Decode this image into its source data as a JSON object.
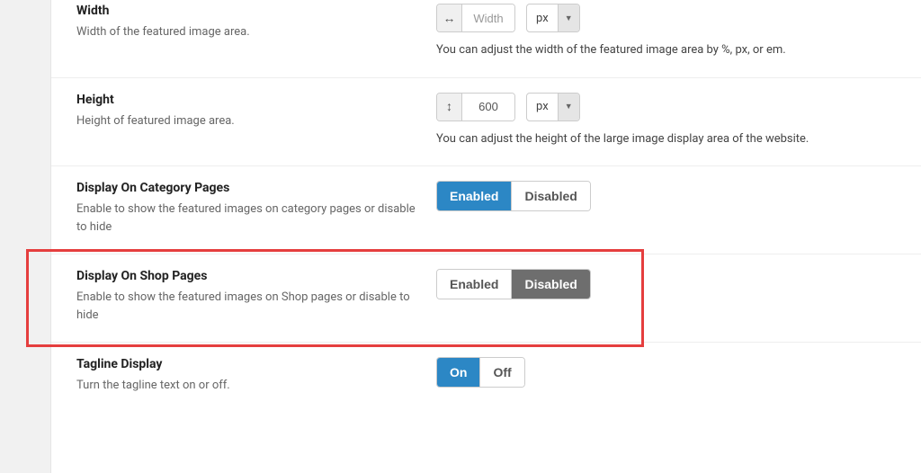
{
  "width": {
    "title": "Width",
    "desc": "Width of the featured image area.",
    "placeholder": "Width",
    "value": "",
    "unit": "px",
    "help": "You can adjust the width of the featured image area by %, px, or em."
  },
  "height": {
    "title": "Height",
    "desc": "Height of featured image area.",
    "value": "600",
    "unit": "px",
    "help": "You can adjust the height of the large image display area of the website."
  },
  "category": {
    "title": "Display On Category Pages",
    "desc": "Enable to show the featured images on category pages or disable to hide",
    "enabled": "Enabled",
    "disabled": "Disabled"
  },
  "shop": {
    "title": "Display On Shop Pages",
    "desc": "Enable to show the featured images on Shop pages or disable to hide",
    "enabled": "Enabled",
    "disabled": "Disabled"
  },
  "tagline": {
    "title": "Tagline Display",
    "desc": "Turn the tagline text on or off.",
    "on": "On",
    "off": "Off"
  }
}
